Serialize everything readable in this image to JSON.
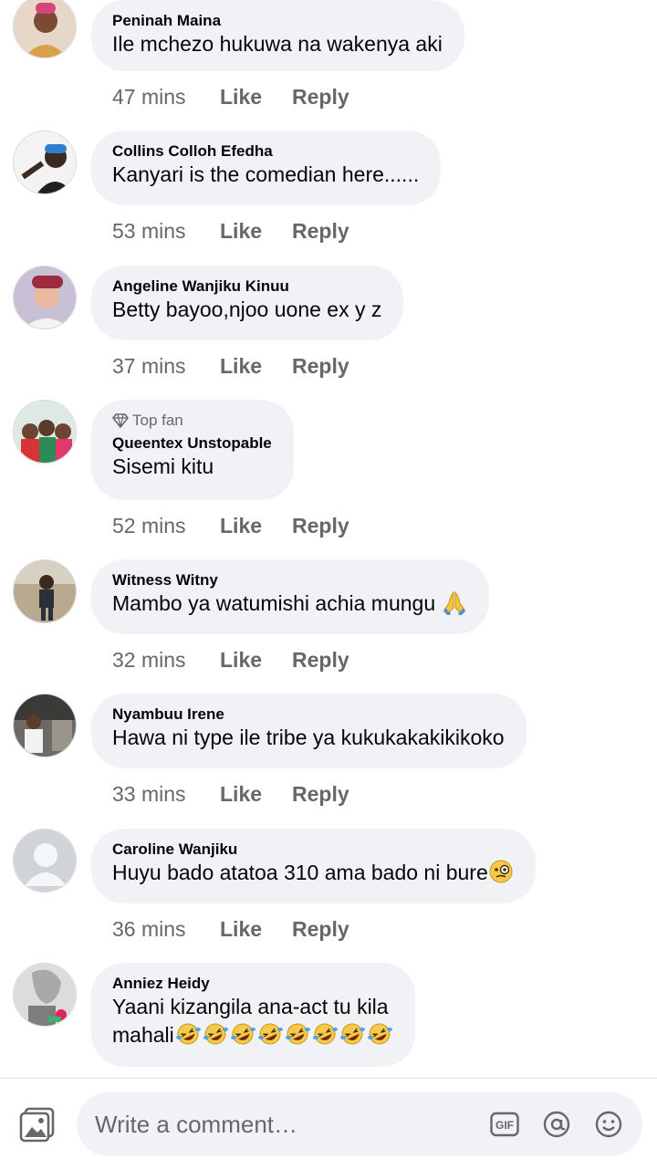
{
  "comments": [
    {
      "name": "Peninah Maina",
      "text": "Ile mchezo hukuwa  na wakenya aki",
      "time": "47 mins",
      "like": "Like",
      "reply": "Reply",
      "top_fan": "",
      "emoji": ""
    },
    {
      "name": "Collins Colloh Efedha",
      "text": "Kanyari is the comedian here......",
      "time": "53 mins",
      "like": "Like",
      "reply": "Reply",
      "top_fan": "",
      "emoji": ""
    },
    {
      "name": "Angeline Wanjiku Kinuu",
      "text": "Betty bayoo,njoo uone ex y z",
      "time": "37 mins",
      "like": "Like",
      "reply": "Reply",
      "top_fan": "",
      "emoji": ""
    },
    {
      "name": "Queentex Unstopable",
      "text": "Sisemi kitu",
      "time": "52 mins",
      "like": "Like",
      "reply": "Reply",
      "top_fan": "Top fan",
      "emoji": ""
    },
    {
      "name": "Witness Witny",
      "text": "Mambo ya watumishi achia mungu",
      "time": "32 mins",
      "like": "Like",
      "reply": "Reply",
      "top_fan": "",
      "emoji": "folded-hands-emoji"
    },
    {
      "name": "Nyambuu Irene",
      "text": "Hawa ni type ile tribe ya kukukakakikikoko",
      "time": "33 mins",
      "like": "Like",
      "reply": "Reply",
      "top_fan": "",
      "emoji": ""
    },
    {
      "name": "Caroline Wanjiku",
      "text": "Huyu bado atatoa 310 ama bado ni bure",
      "time": "36 mins",
      "like": "Like",
      "reply": "Reply",
      "top_fan": "",
      "emoji": "face-with-monocle-emoji"
    },
    {
      "name": "Anniez  Heidy",
      "text": "Yaani kizangila ana-act tu kila",
      "text2": "mahali",
      "top_fan": "",
      "emoji": "rolling-on-the-floor-laughing-emoji x8"
    }
  ],
  "composer": {
    "placeholder": "Write a comment…",
    "photo_icon": "photo-icon",
    "gif_label": "GIF",
    "mention_icon": "at-sign-icon",
    "emoji_icon": "smiley-icon"
  },
  "colors": {
    "bubble": "#f0f2f5",
    "secondary_text": "#65676b",
    "primary_text": "#050505"
  }
}
